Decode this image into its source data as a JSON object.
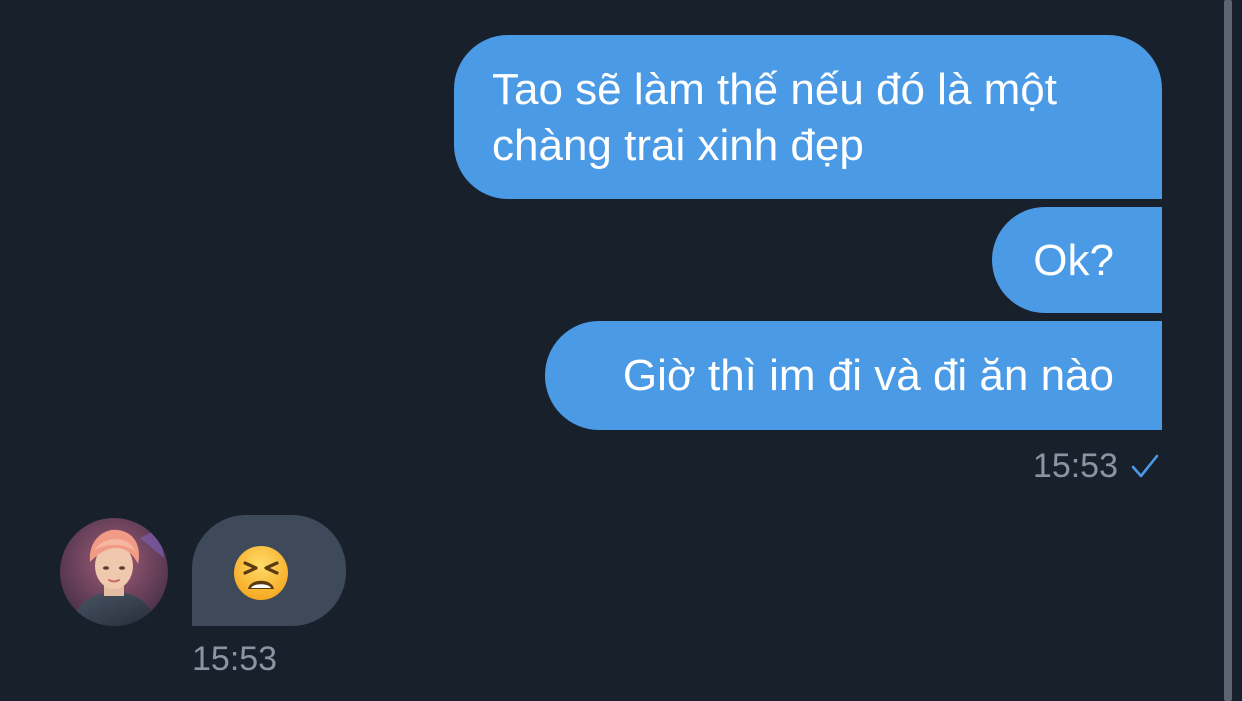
{
  "messages_outgoing": [
    {
      "text": "Tao sẽ làm thế nếu đó là một chàng trai xinh đẹp"
    },
    {
      "text": "Ok?"
    },
    {
      "text": "Giờ thì im đi và đi ăn nào"
    }
  ],
  "outgoing_time": "15:53",
  "outgoing_status_icon": "check-icon",
  "incoming": {
    "emoji_icon": "tired-face-icon",
    "time": "15:53"
  },
  "colors": {
    "background": "#18202b",
    "outgoing_bubble": "#4a9ae6",
    "incoming_bubble": "#3e4a59",
    "timestamp": "#8a94a2",
    "check": "#4a9ae6"
  }
}
